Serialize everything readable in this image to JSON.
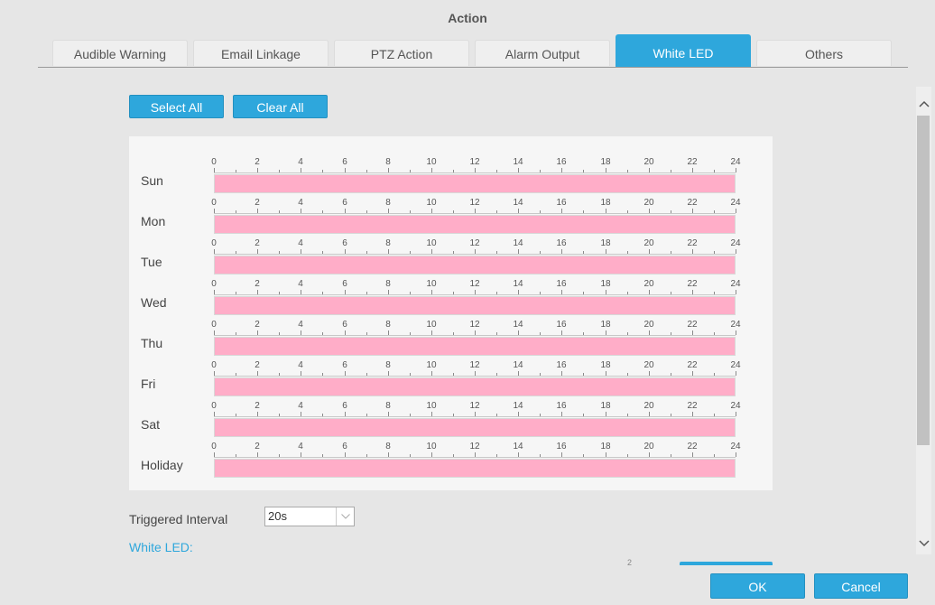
{
  "dialog": {
    "title": "Action"
  },
  "tabs": [
    {
      "label": "Audible Warning",
      "active": false
    },
    {
      "label": "Email Linkage",
      "active": false
    },
    {
      "label": "PTZ Action",
      "active": false
    },
    {
      "label": "Alarm Output",
      "active": false
    },
    {
      "label": "White LED",
      "active": true
    },
    {
      "label": "Others",
      "active": false
    }
  ],
  "toolbar": {
    "select_all_label": "Select All",
    "clear_all_label": "Clear All"
  },
  "schedule": {
    "hour_labels": [
      "0",
      "2",
      "4",
      "6",
      "8",
      "10",
      "12",
      "14",
      "16",
      "18",
      "20",
      "22",
      "24"
    ],
    "days": [
      {
        "label": "Sun",
        "active_ranges": [
          [
            0,
            24
          ]
        ]
      },
      {
        "label": "Mon",
        "active_ranges": [
          [
            0,
            24
          ]
        ]
      },
      {
        "label": "Tue",
        "active_ranges": [
          [
            0,
            24
          ]
        ]
      },
      {
        "label": "Wed",
        "active_ranges": [
          [
            0,
            24
          ]
        ]
      },
      {
        "label": "Thu",
        "active_ranges": [
          [
            0,
            24
          ]
        ]
      },
      {
        "label": "Fri",
        "active_ranges": [
          [
            0,
            24
          ]
        ]
      },
      {
        "label": "Sat",
        "active_ranges": [
          [
            0,
            24
          ]
        ]
      },
      {
        "label": "Holiday",
        "active_ranges": [
          [
            0,
            24
          ]
        ]
      }
    ],
    "active_color": "#ffadc8"
  },
  "triggered_interval": {
    "label": "Triggered Interval",
    "value": "20s"
  },
  "white_led_section": {
    "label": "White LED:"
  },
  "footer": {
    "ok_label": "OK",
    "cancel_label": "Cancel"
  },
  "colors": {
    "accent": "#2ea7dc",
    "background": "#e6e6e6",
    "panel": "#f6f6f6"
  },
  "icons": {
    "scroll_up": "chevron-up-icon",
    "scroll_down": "chevron-down-icon",
    "select_arrow": "chevron-down-icon"
  }
}
